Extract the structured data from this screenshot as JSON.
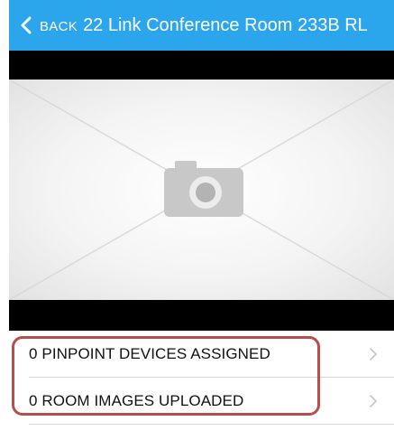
{
  "nav": {
    "back_label": "BACK",
    "title": "22 Link Conference Room 233B RL"
  },
  "room_image": {
    "icon": "camera-icon"
  },
  "list": {
    "items": [
      {
        "label": "0 PINPOINT DEVICES ASSIGNED"
      },
      {
        "label": "0 ROOM IMAGES UPLOADED"
      }
    ]
  },
  "colors": {
    "nav_bar": "#2ba6ed",
    "highlight": "#b94c4c",
    "image_letterbox": "#000000"
  }
}
